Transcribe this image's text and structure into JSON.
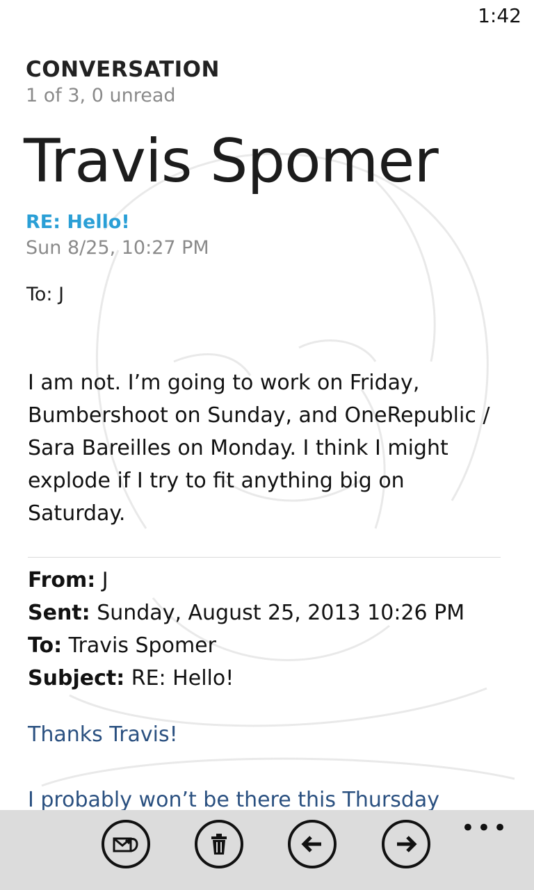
{
  "status": {
    "time": "1:42"
  },
  "header": {
    "app_title": "CONVERSATION",
    "count": "1 of 3, 0 unread"
  },
  "message": {
    "sender": "Travis Spomer",
    "subject": "RE: Hello!",
    "date": "Sun 8/25, 10:27 PM",
    "to": "To: J",
    "body": "I am not.  I’m going to work on Friday, Bumbershoot on Sunday, and OneRepublic / Sara Bareilles on Monday.  I think I might explode if I try to fit anything big on Saturday."
  },
  "quoted": {
    "from_label": "From:",
    "from_value": " J",
    "sent_label": "Sent:",
    "sent_value": " Sunday, August 25, 2013 10:26 PM",
    "to_label": "To:",
    "to_value": " Travis Spomer",
    "subject_label": "Subject:",
    "subject_value": " RE: Hello!",
    "reply_line1": "Thanks Travis!",
    "reply_line2": "I probably won’t be there this Thursday"
  },
  "app_bar": {
    "buttons": [
      {
        "icon": "reply-icon"
      },
      {
        "icon": "delete-icon"
      },
      {
        "icon": "previous-icon"
      },
      {
        "icon": "next-icon"
      }
    ],
    "more_label": "•••"
  }
}
